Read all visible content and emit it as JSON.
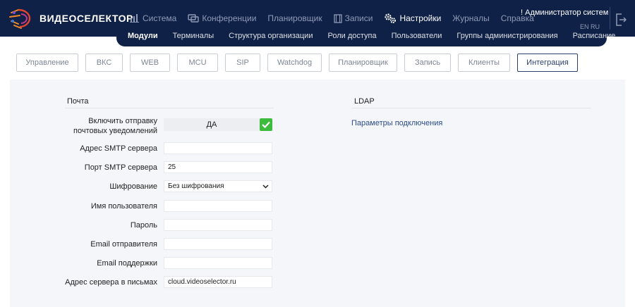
{
  "header": {
    "logo_text": "ВИДЕОСЕЛЕКТОР",
    "nav": [
      {
        "label": "Система",
        "icon": "chart-icon"
      },
      {
        "label": "Конференции",
        "icon": "chat-icon"
      },
      {
        "label": "Планировщик",
        "icon": ""
      },
      {
        "label": "Записи",
        "icon": "film-icon"
      },
      {
        "label": "Настройки",
        "icon": "gears-icon",
        "active": true
      },
      {
        "label": "Журналы",
        "icon": ""
      },
      {
        "label": "Справка",
        "icon": ""
      }
    ],
    "user": "! Администратор систем",
    "lang": "EN RU",
    "subnav": [
      {
        "label": "Модули",
        "active": true
      },
      {
        "label": "Терминалы"
      },
      {
        "label": "Структура организации"
      },
      {
        "label": "Роли доступа"
      },
      {
        "label": "Пользователи"
      },
      {
        "label": "Группы администрирования"
      },
      {
        "label": "Расписание"
      }
    ]
  },
  "tabs": [
    {
      "label": "Управление"
    },
    {
      "label": "ВКС"
    },
    {
      "label": "WEB"
    },
    {
      "label": "MCU"
    },
    {
      "label": "SIP"
    },
    {
      "label": "Watchdog"
    },
    {
      "label": "Планировщик"
    },
    {
      "label": "Запись"
    },
    {
      "label": "Клиенты"
    },
    {
      "label": "Интеграция",
      "active": true
    }
  ],
  "mail": {
    "title": "Почта",
    "enable_label_1": "Включить отправку",
    "enable_label_2": "почтовых уведомлений",
    "enable_value": "ДА",
    "smtp_address_label": "Адрес SMTP сервера",
    "smtp_address_value": "",
    "smtp_port_label": "Порт SMTP сервера",
    "smtp_port_value": "25",
    "encryption_label": "Шифрование",
    "encryption_value": "Без шифрования",
    "username_label": "Имя пользователя",
    "username_value": "",
    "password_label": "Пароль",
    "password_value": "",
    "sender_label": "Email отправителя",
    "sender_value": "",
    "support_label": "Email поддержки",
    "support_value": "",
    "server_in_mail_label": "Адрес сервера в письмах",
    "server_in_mail_value": "cloud.videoselector.ru"
  },
  "ldap": {
    "title": "LDAP",
    "connection_link": "Параметры подключения"
  },
  "colors": {
    "header_bg": "#0f2147",
    "accent_check": "#3dbb3d",
    "active_tab": "#2b3f6b"
  }
}
